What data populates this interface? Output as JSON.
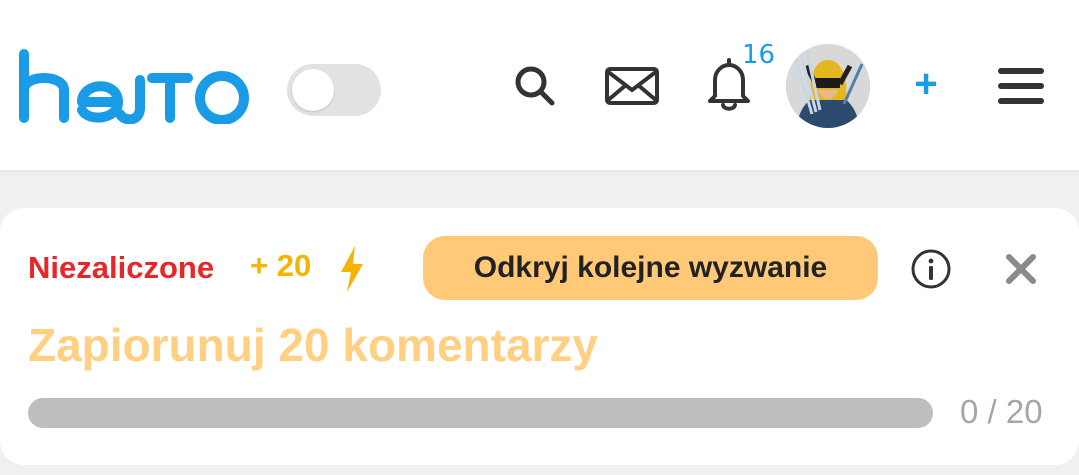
{
  "header": {
    "logo_text": "hejto",
    "theme_toggle": {
      "state": "off"
    },
    "notifications_count": "16",
    "add_label": "+",
    "icons": [
      "search-icon",
      "mail-icon",
      "bell-icon",
      "menu-icon"
    ],
    "accent_color": "#1a9be6"
  },
  "challenge": {
    "status": "Niezaliczone",
    "points": "+ 20",
    "next_button_label": "Odkryj kolejne wyzwanie",
    "title": "Zapiorunuj 20 komentarzy",
    "progress": {
      "current": 0,
      "total": 20,
      "text": "0 / 20"
    },
    "colors": {
      "status": "#e8262a",
      "points": "#f4b400",
      "button": "#ffc978",
      "title": "#ffcf82"
    }
  }
}
